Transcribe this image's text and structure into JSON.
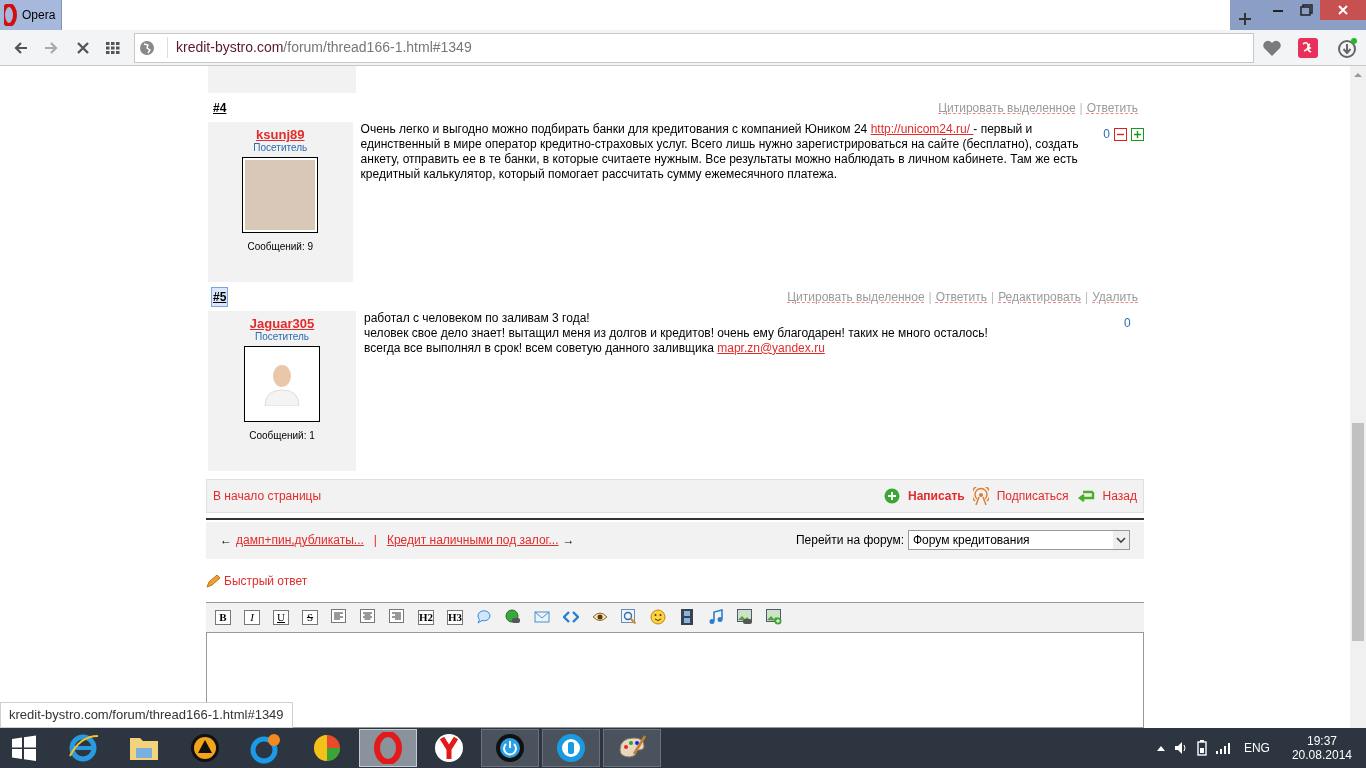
{
  "browser": {
    "tab_title": "Opera",
    "url_domain": "kredit-bystro.com",
    "url_path": "/forum/thread166-1.html#1349"
  },
  "posts": [
    {
      "number": "#4",
      "highlighted": false,
      "author": "ksunj89",
      "role": "Посетитель",
      "avatar": {
        "kind": "photo"
      },
      "messages": "Сообщений: 9",
      "actions": [
        "Цитировать выделенное",
        "Ответить"
      ],
      "rating": "0",
      "votes": true,
      "body": [
        [
          {
            "kind": "text",
            "text": "Очень легко и выгодно можно подбирать банки для кредитования с компанией Юником 24 "
          },
          {
            "kind": "link",
            "text": "http://unicom24.ru/ "
          },
          {
            "kind": "text",
            "text": " - первый и единственный в мире оператор кредитно-страховых услуг. Всего лишь нужно зарегистрироваться на сайте (бесплатно), создать анкету, отправить ее в те банки, в которые считаете нужным. Все результаты можно наблюдать в личном кабинете. Там же есть кредитный калькулятор, который помогает рассчитать сумму ежемесячного платежа."
          }
        ]
      ]
    },
    {
      "number": "#5",
      "highlighted": true,
      "author": "Jaguar305",
      "role": "Посетитель",
      "avatar": {
        "kind": "default"
      },
      "messages": "Сообщений: 1",
      "actions": [
        "Цитировать выделенное",
        "Ответить",
        "Редактировать",
        "Удалить"
      ],
      "rating": "0",
      "votes": false,
      "body": [
        [
          {
            "kind": "text",
            "text": "работал с человеком по заливам 3 года!"
          }
        ],
        [
          {
            "kind": "text",
            "text": "человек свое дело знает! вытащил меня из долгов и кредитов! очень ему благодарен! таких не много осталось!"
          }
        ],
        [
          {
            "kind": "text",
            "text": "всегда все выполнял в срок! всем советую данного заливщика "
          },
          {
            "kind": "link",
            "text": "mapr.zn@yandex.ru"
          }
        ]
      ]
    }
  ],
  "footer": {
    "top_link": "В начало страницы",
    "actions": [
      {
        "kind": "write",
        "label": "Написать"
      },
      {
        "kind": "subscribe",
        "label": "Подписаться"
      },
      {
        "kind": "back",
        "label": "Назад"
      }
    ]
  },
  "thread_nav": {
    "prev_arrow": "←",
    "prev": "дамп+пин,дубликаты...",
    "separator": "|",
    "next": "Кредит наличными под залог...",
    "next_arrow": "→",
    "forum_label": "Перейти на форум:",
    "forum_value": "Форум кредитования"
  },
  "quick_reply": {
    "title": "Быстрый ответ"
  },
  "editor_toolbar": [
    {
      "kind": "bold",
      "label": "B"
    },
    {
      "kind": "italic",
      "label": "I"
    },
    {
      "kind": "underline",
      "label": "U"
    },
    {
      "kind": "strike",
      "label": "S"
    },
    {
      "kind": "align-left"
    },
    {
      "kind": "align-center"
    },
    {
      "kind": "align-right"
    },
    {
      "kind": "heading",
      "label": "H2"
    },
    {
      "kind": "heading",
      "label": "H3"
    },
    {
      "kind": "speech"
    },
    {
      "kind": "globe"
    },
    {
      "kind": "mail"
    },
    {
      "kind": "code"
    },
    {
      "kind": "eye"
    },
    {
      "kind": "zoom"
    },
    {
      "kind": "smiley"
    },
    {
      "kind": "film"
    },
    {
      "kind": "music"
    },
    {
      "kind": "image-link"
    },
    {
      "kind": "image-add"
    }
  ],
  "action_separator": "|",
  "status_url": "kredit-bystro.com/forum/thread166-1.html#1349",
  "taskbar": {
    "apps": [
      {
        "kind": "ie",
        "running": false,
        "selected": false
      },
      {
        "kind": "folder",
        "running": false,
        "selected": false
      },
      {
        "kind": "triangle",
        "running": false,
        "selected": false
      },
      {
        "kind": "chat",
        "running": false,
        "selected": false
      },
      {
        "kind": "sphere",
        "running": false,
        "selected": false
      },
      {
        "kind": "opera",
        "running": true,
        "selected": true
      },
      {
        "kind": "yandex",
        "running": false,
        "selected": false
      },
      {
        "kind": "power",
        "running": true,
        "selected": false
      },
      {
        "kind": "b",
        "running": true,
        "selected": false
      },
      {
        "kind": "paint",
        "running": true,
        "selected": false
      }
    ],
    "language": "ENG",
    "time": "19:37",
    "date": "20.08.2014"
  }
}
